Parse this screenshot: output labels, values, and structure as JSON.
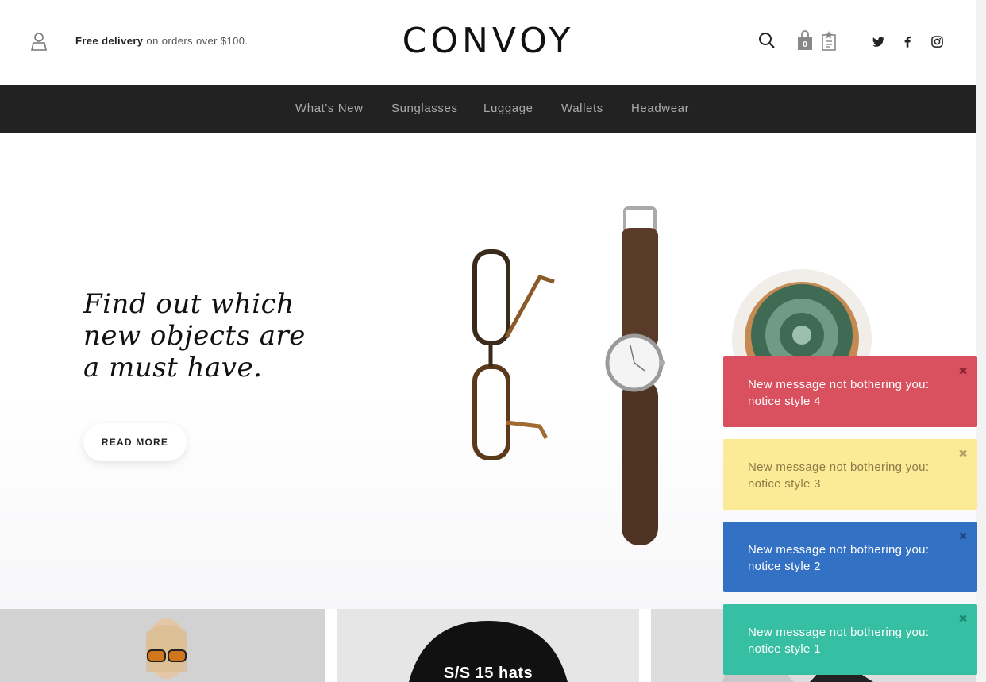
{
  "header": {
    "delivery_bold": "Free delivery",
    "delivery_rest": " on orders over $100.",
    "logo": "CONVOY",
    "cart_count": "0",
    "social": {
      "twitter": "𝕥",
      "facebook": "f",
      "instagram": "◎"
    }
  },
  "nav": {
    "items": [
      {
        "label": "What's New"
      },
      {
        "label": "Sunglasses"
      },
      {
        "label": "Luggage"
      },
      {
        "label": "Wallets"
      },
      {
        "label": "Headwear"
      }
    ]
  },
  "hero": {
    "title_line1": "Find out which",
    "title_line2": "new objects are",
    "title_line3": "a must have.",
    "button": "READ MORE"
  },
  "cards": [
    {
      "label": ""
    },
    {
      "label": "S/S 15 hats"
    },
    {
      "label": ""
    }
  ],
  "notices": [
    {
      "text": "New message not bothering you: notice style 4",
      "bg": "#d9505f",
      "fg": "#ffffff",
      "close": "✖",
      "close_color": "#8a2430"
    },
    {
      "text": "New message not bothering you: notice style 3",
      "bg": "#fbeb97",
      "fg": "#8b7b47",
      "close": "✖",
      "close_color": "#b3a36a"
    },
    {
      "text": "New message not bothering you: notice style 2",
      "bg": "#3271c4",
      "fg": "#ffffff",
      "close": "✖",
      "close_color": "#1d4a86"
    },
    {
      "text": "New message not bothering you: notice style 1",
      "bg": "#36bfa3",
      "fg": "#ffffff",
      "close": "✖",
      "close_color": "#1f8a73"
    }
  ]
}
